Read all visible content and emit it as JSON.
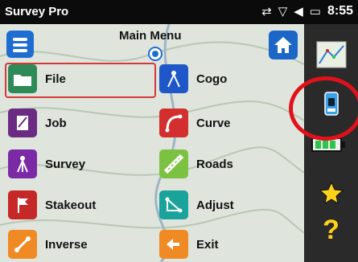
{
  "titlebar": {
    "app_title": "Survey Pro",
    "time": "8:55"
  },
  "main": {
    "title": "Main Menu",
    "items": [
      {
        "label": "File",
        "icon": "folder-icon",
        "color": "#2e8b57"
      },
      {
        "label": "Job",
        "icon": "job-icon",
        "color": "#6b2b83"
      },
      {
        "label": "Survey",
        "icon": "survey-icon",
        "color": "#7b2aa6"
      },
      {
        "label": "Stakeout",
        "icon": "stakeout-flag-icon",
        "color": "#c62828"
      },
      {
        "label": "Inverse",
        "icon": "inverse-icon",
        "color": "#f08a24"
      },
      {
        "label": "Cogo",
        "icon": "cogo-compass-icon",
        "color": "#1e57c7"
      },
      {
        "label": "Curve",
        "icon": "curve-icon",
        "color": "#d32f2f"
      },
      {
        "label": "Roads",
        "icon": "roads-icon",
        "color": "#7cc242"
      },
      {
        "label": "Adjust",
        "icon": "adjust-icon",
        "color": "#1aa39a"
      },
      {
        "label": "Exit",
        "icon": "exit-back-arrow-icon",
        "color": "#f08a24"
      }
    ]
  },
  "toolbar": {
    "icons": [
      "map-view-icon",
      "total-station-icon",
      "battery-icon",
      "favorites-star-icon",
      "help-icon"
    ]
  },
  "colors": {
    "highlight": "#e0111b",
    "accent_blue": "#1f6dd1"
  }
}
